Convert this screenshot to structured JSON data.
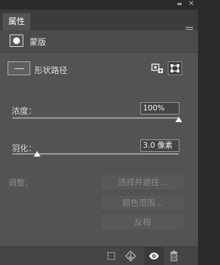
{
  "window": {
    "collapse_glyph": "◂◂",
    "close_glyph": "✕"
  },
  "tab": {
    "label": "属性"
  },
  "header": {
    "title": "蒙版",
    "icon": "layer-mask-icon"
  },
  "vector_mask": {
    "label": "形状路径",
    "icons": [
      "add-vector-mask-icon",
      "select-vector-mask-icon"
    ]
  },
  "density": {
    "label": "浓度：",
    "value": "100%",
    "level_percent": 100
  },
  "feather": {
    "label": "羽化：",
    "value": "3.0 像素",
    "level_fraction": 0.03
  },
  "refine": {
    "label": "调整：",
    "buttons": [
      "选择并遮住...",
      "颜色范围...",
      "反相"
    ]
  },
  "footer": {
    "icons": [
      "load-selection-icon",
      "apply-mask-icon",
      "visibility-eye-icon",
      "trash-icon"
    ]
  },
  "colors": {
    "panel": "#535353",
    "tab_bar": "#3c3c3c",
    "field_bg": "#454545",
    "text": "#dcdcdc"
  }
}
